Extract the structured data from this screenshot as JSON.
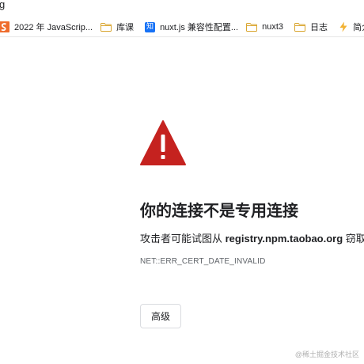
{
  "address_bar": {
    "url_fragment": "g"
  },
  "bookmarks": [
    {
      "icon": "s-logo-icon",
      "label": "2022 年 JavaScrip..."
    },
    {
      "icon": "folder-icon",
      "label": "库课"
    },
    {
      "icon": "zhihu-icon",
      "label": "nuxt.js 兼容性配置..."
    },
    {
      "icon": "folder-icon",
      "label": "nuxt3"
    },
    {
      "icon": "folder-icon",
      "label": "日志"
    },
    {
      "icon": "bolt-icon",
      "label": "简介 |沃尔特"
    }
  ],
  "zhihu_glyph": "知",
  "error_page": {
    "title": "你的连接不是专用连接",
    "desc_prefix": "攻击者可能试图从 ",
    "desc_host": "registry.npm.taobao.org",
    "desc_suffix": " 窃取你",
    "error_code": "NET::ERR_CERT_DATE_INVALID",
    "advanced_label": "高级"
  },
  "watermark": "@稀土掘金技术社区",
  "colors": {
    "warning_red": "#c5221f",
    "folder_gold": "#e8b33e",
    "zhihu_blue": "#1772f6"
  }
}
